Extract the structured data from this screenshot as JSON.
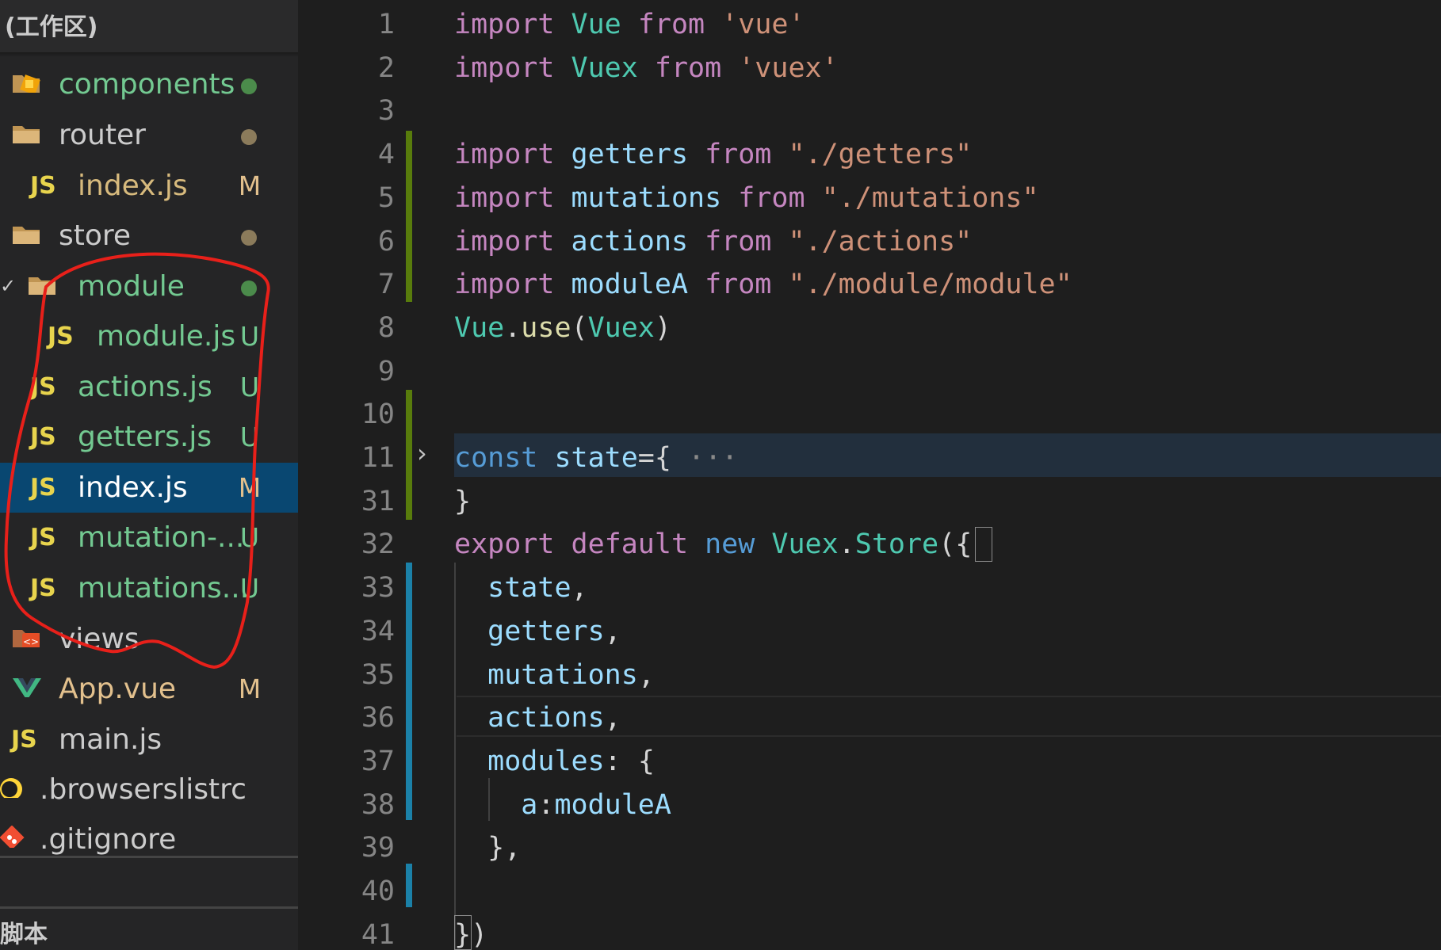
{
  "sidebar": {
    "header": "(工作区)",
    "bottom_section": "脚本",
    "items": [
      {
        "label": "components",
        "badge": "",
        "dot_color": "#4b8b4b",
        "label_color": "#73c991",
        "icon": "components-folder-icon"
      },
      {
        "label": "router",
        "badge": "",
        "dot_color": "#8b7b5b",
        "label_color": "#cccccc",
        "icon": "folder-icon"
      },
      {
        "label": "index.js",
        "badge": "M",
        "label_color": "#d7ba7d",
        "icon": "js-icon"
      },
      {
        "label": "store",
        "badge": "",
        "dot_color": "#8b7b5b",
        "label_color": "#cccccc",
        "icon": "folder-icon"
      },
      {
        "label": "module",
        "badge": "",
        "dot_color": "#4b8b4b",
        "label_color": "#73c991",
        "icon": "folder-icon"
      },
      {
        "label": "module.js",
        "badge": "U",
        "label_color": "#73c991",
        "icon": "js-icon"
      },
      {
        "label": "actions.js",
        "badge": "U",
        "label_color": "#73c991",
        "icon": "js-icon"
      },
      {
        "label": "getters.js",
        "badge": "U",
        "label_color": "#73c991",
        "icon": "js-icon"
      },
      {
        "label": "index.js",
        "badge": "M",
        "label_color": "#e2c08d",
        "icon": "js-icon",
        "selected": true
      },
      {
        "label": "mutation-...",
        "badge": "U",
        "label_color": "#73c991",
        "icon": "js-icon"
      },
      {
        "label": "mutations...",
        "badge": "U",
        "label_color": "#73c991",
        "icon": "js-icon"
      },
      {
        "label": "views",
        "badge": "",
        "label_color": "#cccccc",
        "icon": "views-folder-icon"
      },
      {
        "label": "App.vue",
        "badge": "M",
        "label_color": "#e2c08d",
        "icon": "vue-icon"
      },
      {
        "label": "main.js",
        "badge": "",
        "label_color": "#cccccc",
        "icon": "js-icon"
      },
      {
        "label": ".browserslistrc",
        "badge": "",
        "label_color": "#cccccc",
        "icon": "browserslist-icon"
      },
      {
        "label": ".gitignore",
        "badge": "",
        "label_color": "#cccccc",
        "icon": "git-icon"
      }
    ],
    "js_icon_text": "JS"
  },
  "editor": {
    "line_numbers": [
      "1",
      "2",
      "3",
      "4",
      "5",
      "6",
      "7",
      "8",
      "9",
      "10",
      "11",
      "31",
      "32",
      "33",
      "34",
      "35",
      "36",
      "37",
      "38",
      "39",
      "40",
      "41"
    ],
    "lines": [
      [
        [
          "kw",
          "import "
        ],
        [
          "id",
          "Vue "
        ],
        [
          "kw",
          "from "
        ],
        [
          "str",
          "'vue'"
        ]
      ],
      [
        [
          "kw",
          "import "
        ],
        [
          "id",
          "Vuex "
        ],
        [
          "kw",
          "from "
        ],
        [
          "str",
          "'vuex'"
        ]
      ],
      [],
      [
        [
          "kw",
          "import "
        ],
        [
          "var",
          "getters "
        ],
        [
          "kw",
          "from "
        ],
        [
          "str",
          "\"./getters\""
        ]
      ],
      [
        [
          "kw",
          "import "
        ],
        [
          "var",
          "mutations "
        ],
        [
          "kw",
          "from "
        ],
        [
          "str",
          "\"./mutations\""
        ]
      ],
      [
        [
          "kw",
          "import "
        ],
        [
          "var",
          "actions "
        ],
        [
          "kw",
          "from "
        ],
        [
          "str",
          "\"./actions\""
        ]
      ],
      [
        [
          "kw",
          "import "
        ],
        [
          "var",
          "moduleA "
        ],
        [
          "kw",
          "from "
        ],
        [
          "str",
          "\"./module/module\""
        ]
      ],
      [
        [
          "id",
          "Vue"
        ],
        [
          "pun",
          "."
        ],
        [
          "fn",
          "use"
        ],
        [
          "pun",
          "("
        ],
        [
          "id",
          "Vuex"
        ],
        [
          "pun",
          ")"
        ]
      ],
      [],
      [],
      [
        [
          "kwb",
          "const "
        ],
        [
          "var",
          "state"
        ],
        [
          "pun",
          "={ "
        ],
        [
          "dim",
          "···"
        ]
      ],
      [
        [
          "pun",
          "}"
        ]
      ],
      [
        [
          "kw",
          "export "
        ],
        [
          "kw",
          "default "
        ],
        [
          "kwb",
          "new "
        ],
        [
          "id",
          "Vuex"
        ],
        [
          "pun",
          "."
        ],
        [
          "id",
          "Store"
        ],
        [
          "pun",
          "({"
        ]
      ],
      [
        [
          "pun",
          "  "
        ],
        [
          "var",
          "state"
        ],
        [
          "pun",
          ","
        ]
      ],
      [
        [
          "pun",
          "  "
        ],
        [
          "var",
          "getters"
        ],
        [
          "pun",
          ","
        ]
      ],
      [
        [
          "pun",
          "  "
        ],
        [
          "var",
          "mutations"
        ],
        [
          "pun",
          ","
        ]
      ],
      [
        [
          "pun",
          "  "
        ],
        [
          "var",
          "actions"
        ],
        [
          "pun",
          ","
        ]
      ],
      [
        [
          "pun",
          "  "
        ],
        [
          "var",
          "modules"
        ],
        [
          "pun",
          ": {"
        ]
      ],
      [
        [
          "pun",
          "    "
        ],
        [
          "var",
          "a"
        ],
        [
          "pun",
          ":"
        ],
        [
          "var",
          "moduleA"
        ]
      ],
      [
        [
          "pun",
          "  },"
        ]
      ],
      [],
      [
        [
          "pun",
          "})"
        ]
      ]
    ],
    "fold_indicator": "›"
  },
  "colors": {
    "added_bar": "#587c0c",
    "modified_bar": "#1b81a8",
    "selected_row": "#094771",
    "annotation_stroke": "#e8201a"
  }
}
